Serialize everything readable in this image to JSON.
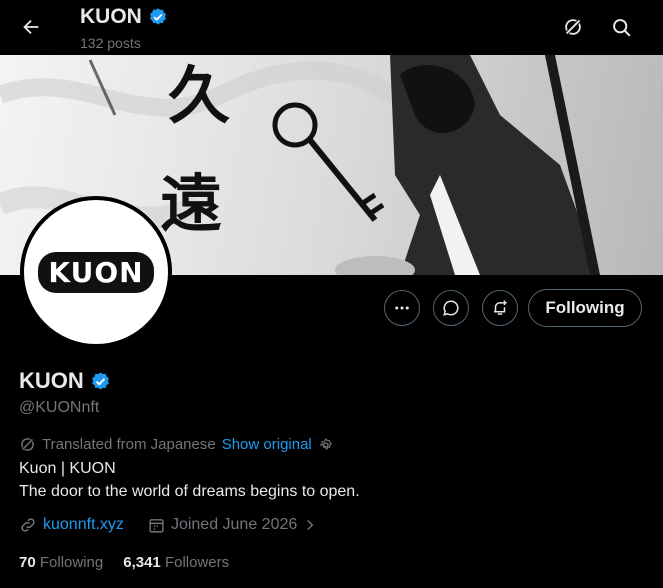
{
  "header": {
    "title": "KUON",
    "posts_count": "132 posts"
  },
  "banner": {
    "kanji_1": "久",
    "kanji_2": "遠"
  },
  "avatar": {
    "logo_text": "KUON"
  },
  "actions": {
    "follow_label": "Following"
  },
  "profile": {
    "display_name": "KUON",
    "handle": "@KUONnft",
    "translated_from": "Translated from Japanese",
    "show_original": "Show original",
    "bio_line1": "Kuon | KUON",
    "bio_line2": "The door to the world of dreams begins to open.",
    "website": "kuonnft.xyz",
    "joined": "Joined June 2026"
  },
  "stats": {
    "following_count": "70",
    "following_label": "Following",
    "followers_count": "6,341",
    "followers_label": "Followers"
  },
  "colors": {
    "accent": "#1d9bf0",
    "verified": "#1d9bf0",
    "muted": "#71767b"
  }
}
